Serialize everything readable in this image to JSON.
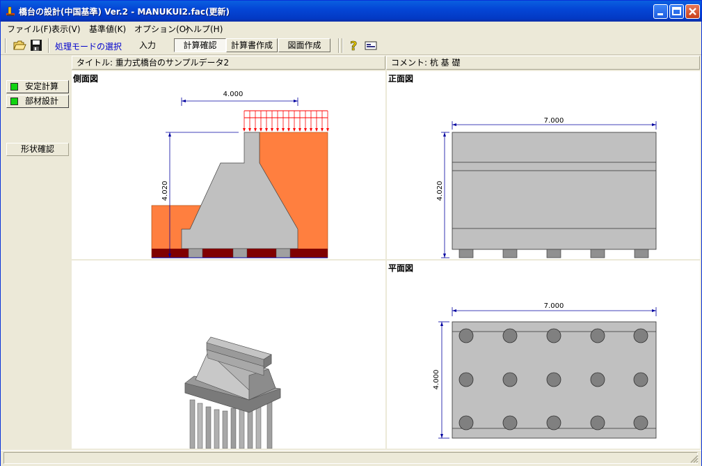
{
  "window": {
    "title": "橋台の設計(中国基準) Ver.2 - MANUKUI2.fac(更新)"
  },
  "menu": [
    {
      "label": "ファイル(F)"
    },
    {
      "label": "表示(V)"
    },
    {
      "label": "基準値(K)"
    },
    {
      "label": "オプション(O)"
    },
    {
      "label": "ヘルプ(H)"
    }
  ],
  "toolbar": {
    "mode_label": "処理モードの選択",
    "tabs": [
      {
        "label": "入力",
        "state": "flat"
      },
      {
        "label": "計算確認",
        "state": "pressed"
      },
      {
        "label": "計算書作成",
        "state": "raised"
      },
      {
        "label": "図面作成",
        "state": "raised"
      }
    ]
  },
  "info": {
    "title_label": "タイトル: 重力式橋台のサンプルデータ2",
    "comment_label": "コメント: 杭 基 礎"
  },
  "left_panel": {
    "buttons": [
      {
        "label": "安定計算"
      },
      {
        "label": "部材設計"
      }
    ],
    "shape_check": "形状確認"
  },
  "views": {
    "side": {
      "title": "側面図",
      "dim_width": "4.000",
      "dim_height": "4.020"
    },
    "front": {
      "title": "正面図",
      "dim_width": "7.000",
      "dim_height": "4.020"
    },
    "plan": {
      "title": "平面図",
      "dim_width": "7.000",
      "dim_height": "4.000"
    }
  },
  "colors": {
    "soil": "#ff7f3f",
    "concrete": "#c0c0c0",
    "pile_cap_dark": "#800000",
    "load_arrow": "#ff0000",
    "dimension": "#0000a0"
  }
}
